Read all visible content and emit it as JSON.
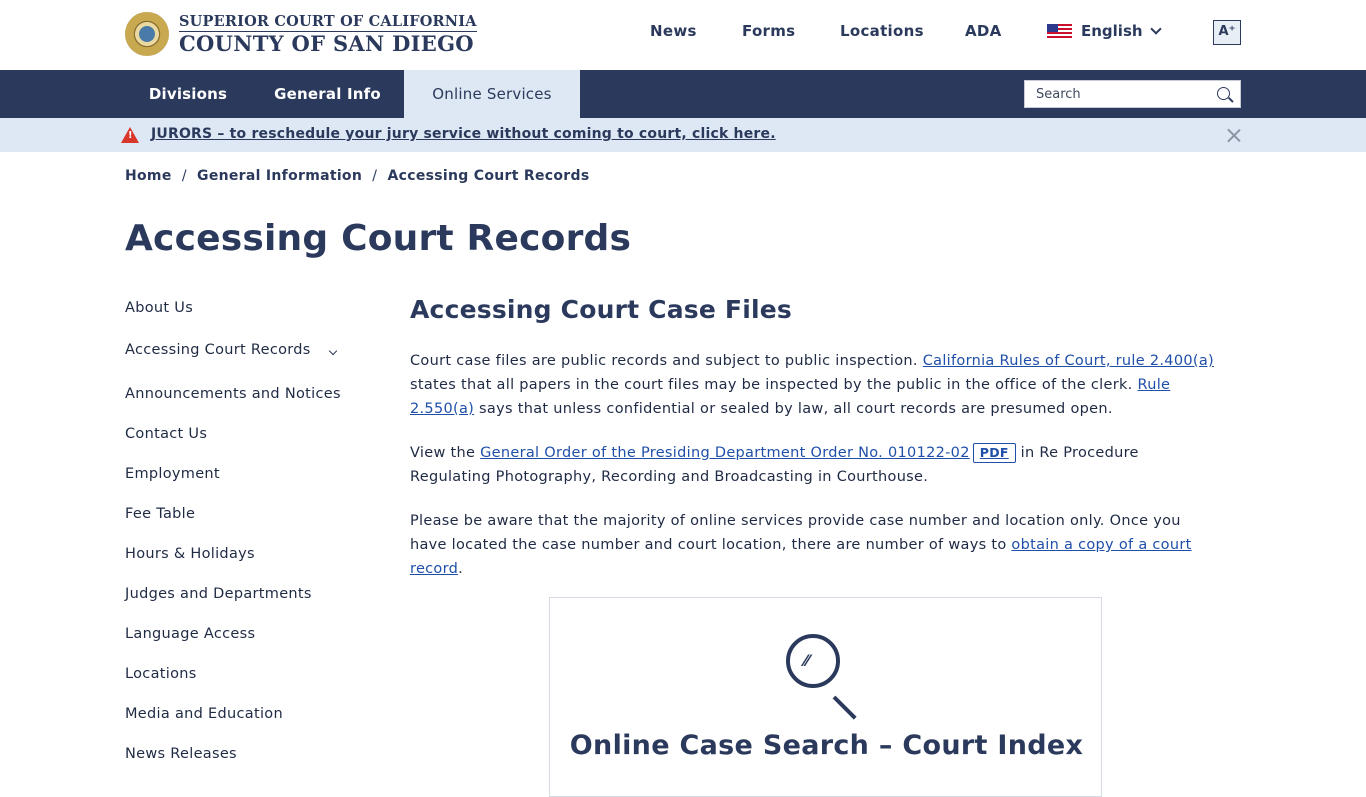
{
  "header": {
    "logo_line1": "SUPERIOR COURT OF CALIFORNIA",
    "logo_line2": "COUNTY OF SAN DIEGO",
    "top_links": [
      "News",
      "Forms",
      "Locations",
      "ADA"
    ],
    "language": "English",
    "text_size_label": "A⁺"
  },
  "nav": {
    "items": [
      "Divisions",
      "General Info",
      "Online Services"
    ],
    "active": "Online Services",
    "search_placeholder": "Search"
  },
  "alert": {
    "text": "JURORS – to reschedule your jury service without coming to court, click here."
  },
  "breadcrumb": {
    "items": [
      "Home",
      "General Information",
      "Accessing Court Records"
    ],
    "separator": "/"
  },
  "page_title": "Accessing Court Records",
  "sidebar": {
    "items": [
      "About Us",
      "Accessing Court Records",
      "Announcements and Notices",
      "Contact Us",
      "Employment",
      "Fee Table",
      "Hours & Holidays",
      "Judges and Departments",
      "Language Access",
      "Locations",
      "Media and Education",
      "News Releases"
    ]
  },
  "content": {
    "heading": "Accessing Court Case Files",
    "p1": {
      "t1": "Court case files are public records and subject to public inspection. ",
      "link1": "California Rules of Court, rule 2.400(a)",
      "t2": " states that all papers in the court files may be inspected by the public in the office of the clerk. ",
      "link2": "Rule 2.550(a)",
      "t3": " says that unless confidential or sealed by law, all court records are presumed open."
    },
    "p2": {
      "t1": "View the ",
      "link1": "General Order of the Presiding Department Order No. 010122-02",
      "badge": "PDF",
      "t2": " in Re Procedure Regulating Photography, Recording and Broadcasting in Courthouse."
    },
    "p3": {
      "t1": "Please be aware that the majority of online services provide case number and location only.  Once you have located the case number and court location, there are number of ways to ",
      "link1": "obtain a copy of a court record",
      "t2": "."
    },
    "card_title": "Online Case Search – Court Index"
  },
  "colors": {
    "navy": "#2b3a5c",
    "light_blue": "#dde8f4",
    "link": "#1f4fa8",
    "alert_red": "#d9372b"
  }
}
